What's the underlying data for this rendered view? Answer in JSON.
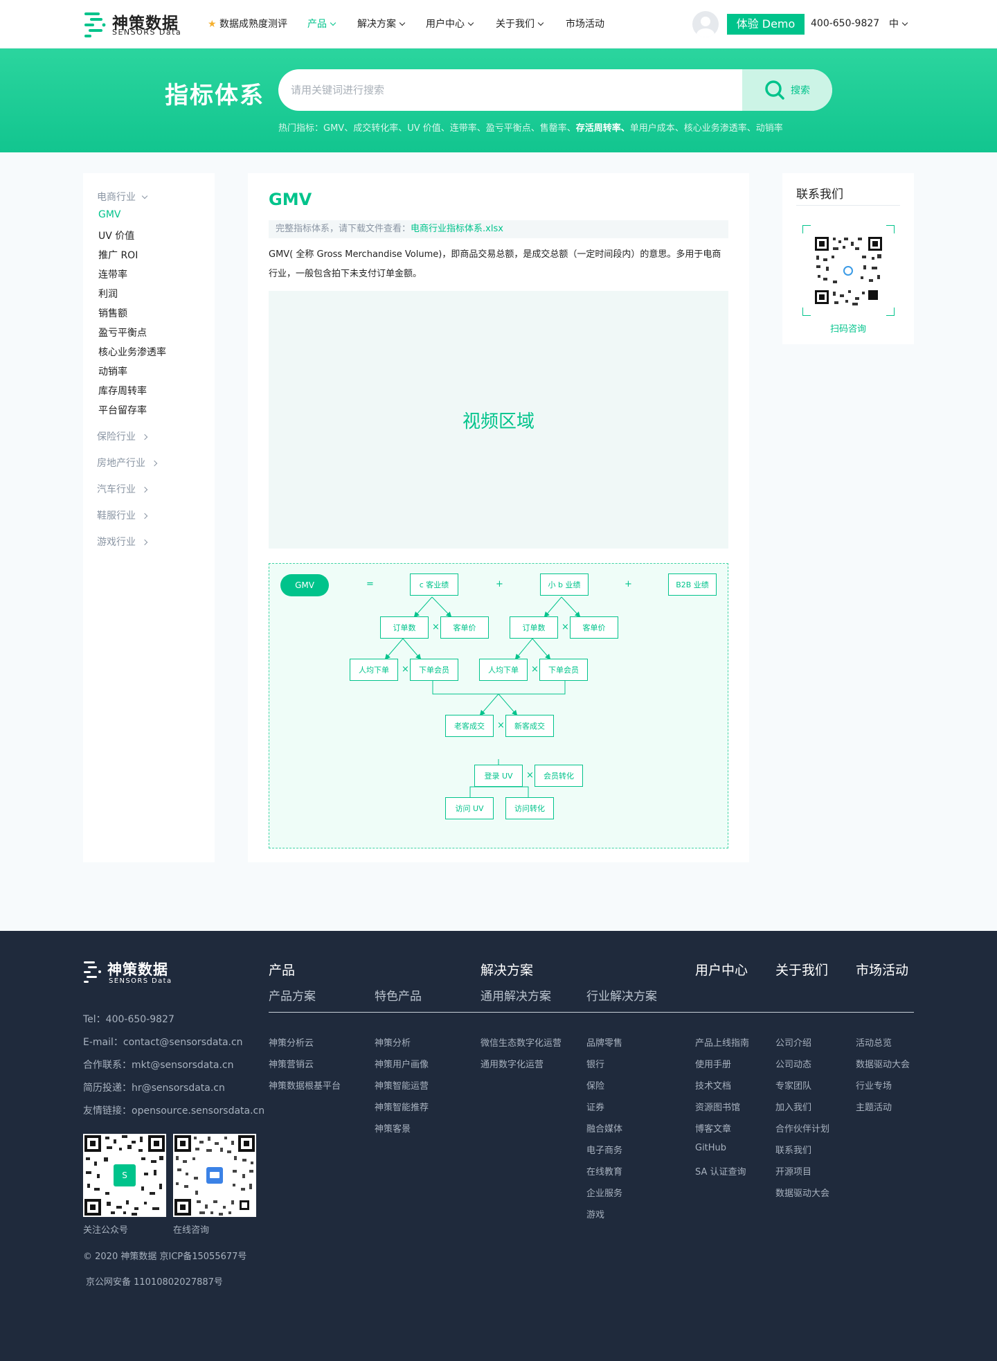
{
  "header": {
    "logo_cn": "神策数据",
    "logo_en": "SENSORS Data",
    "nav": [
      {
        "label": "数据成熟度测评",
        "has_dropdown": false,
        "active": false
      },
      {
        "label": "产品",
        "has_dropdown": true,
        "active": true
      },
      {
        "label": "解决方案",
        "has_dropdown": true,
        "active": false
      },
      {
        "label": "用户中心",
        "has_dropdown": true,
        "active": false
      },
      {
        "label": "关于我们",
        "has_dropdown": true,
        "active": false
      },
      {
        "label": "市场活动",
        "has_dropdown": false,
        "active": false
      }
    ],
    "demo_label": "体验 Demo",
    "phone": "400-650-9827",
    "lang": "中"
  },
  "hero": {
    "title": "指标体系",
    "search_placeholder": "请用关键词进行搜索",
    "search_button": "搜索",
    "hot_prefix": "热门指标：",
    "hot_before": "GMV、成交转化率、UV 价值、连带率、盈亏平衡点、售罄率、",
    "hot_highlight": "存活周转率、",
    "hot_after": "单用户成本、核心业务渗透率、动销率"
  },
  "sidebar": {
    "expanded_category": "电商行业",
    "items": [
      "GMV",
      "UV 价值",
      "推广 ROI",
      "连带率",
      "利润",
      "销售额",
      "盈亏平衡点",
      "核心业务渗透率",
      "动销率",
      "库存周转率",
      "平台留存率"
    ],
    "active_item": "GMV",
    "collapsed_categories": [
      "保险行业",
      "房地产行业",
      "汽车行业",
      "鞋服行业",
      "游戏行业"
    ]
  },
  "main": {
    "title": "GMV",
    "download_prefix": "完整指标体系，请下载文件查看：",
    "download_link": "电商行业指标体系.xlsx",
    "description": "GMV( 全称 Gross Merchandise Volume)，即商品交易总额，是成交总额（一定时间段内）的意思。多用于电商行业，一般包含拍下未支付订单金额。",
    "video_label": "视频区域",
    "tree": {
      "root": "GMV",
      "equals": "=",
      "plus": "+",
      "times": "×",
      "c_customer": "c 客业绩",
      "small_b": "小 b 业绩",
      "b2b": "B2B 业绩",
      "orders_1": "订单数",
      "aov_1": "客单价",
      "orders_2": "订单数",
      "aov_2": "客单价",
      "per_capita_1": "人均下单",
      "ordering_members_1": "下单会员",
      "per_capita_2": "人均下单",
      "ordering_members_2": "下单会员",
      "old_customer": "老客成交",
      "new_customer": "新客成交",
      "login_uv": "登录 UV",
      "member_conversion": "会员转化",
      "visit_uv": "访问 UV",
      "visit_conversion": "访问转化"
    }
  },
  "contact": {
    "title": "联系我们",
    "qr_label": "扫码咨询"
  },
  "footer": {
    "logo_cn": "神策数据",
    "logo_en": "SENSORS Data",
    "tel": "Tel：400-650-9827",
    "email_label": "E-mail：",
    "email": "contact@sensorsdata.cn",
    "coop_label": "合作联系：",
    "coop": "mkt@sensorsdata.cn",
    "resume_label": "简历投递：",
    "resume": "hr@sensorsdata.cn",
    "friend_label": "友情链接：",
    "friend": "opensource.sensorsdata.cn",
    "qr1_label": "关注公众号",
    "qr2_label": "在线咨询",
    "copyright": "© 2020 神策数据 京ICP备15055677号",
    "police": "京公网安备 11010802027887号",
    "headings": {
      "product": "产品",
      "solution": "解决方案",
      "user_center": "用户中心",
      "about": "关于我们",
      "market": "市场活动"
    },
    "subheadings": {
      "product_plan": "产品方案",
      "feature_product": "特色产品",
      "general_solution": "通用解决方案",
      "industry_solution": "行业解决方案"
    },
    "col_product_plan": [
      "神策分析云",
      "神策营销云",
      "神策数据根基平台"
    ],
    "col_feature_product": [
      "神策分析",
      "神策用户画像",
      "神策智能运营",
      "神策智能推荐",
      "神策客景"
    ],
    "col_general_solution": [
      "微信生态数字化运营",
      "通用数字化运营"
    ],
    "col_industry_solution": [
      "品牌零售",
      "银行",
      "保险",
      "证券",
      "融合媒体",
      "电子商务",
      "在线教育",
      "企业服务",
      "游戏"
    ],
    "col_user_center": [
      "产品上线指南",
      "使用手册",
      "技术文档",
      "资源图书馆",
      "博客文章",
      "GitHub",
      "SA 认证查询"
    ],
    "col_about": [
      "公司介绍",
      "公司动态",
      "专家团队",
      "加入我们",
      "合作伙伴计划",
      "联系我们",
      "开源项目",
      "数据驱动大会"
    ],
    "col_market": [
      "活动总览",
      "数据驱动大会",
      "行业专场",
      "主题活动"
    ]
  },
  "colors": {
    "brand": "#00c38b",
    "footer_bg": "#1f2a3c",
    "hero_start": "#2bd59e",
    "hero_end": "#12c58f"
  }
}
